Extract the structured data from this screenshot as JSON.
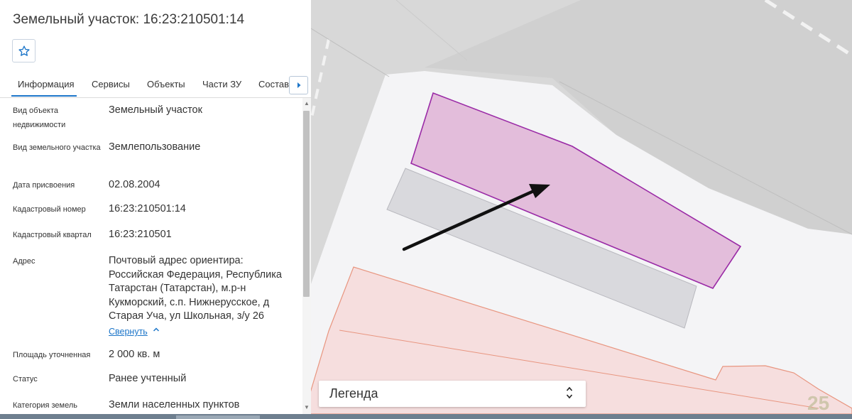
{
  "title": "Земельный участок: 16:23:210501:14",
  "favorite_icon": "star-outline-icon",
  "tabs": [
    {
      "label": "Информация"
    },
    {
      "label": "Сервисы"
    },
    {
      "label": "Объекты"
    },
    {
      "label": "Части ЗУ"
    },
    {
      "label": "Состав"
    }
  ],
  "tabs_scroll_icon": "caret-right-icon",
  "properties": [
    {
      "label": "Вид объекта недвижимости",
      "value": "Земельный участок"
    },
    {
      "label": "Вид земельного участка",
      "value": "Землепользование"
    },
    {
      "label": "Дата присвоения",
      "value": "02.08.2004"
    },
    {
      "label": "Кадастровый номер",
      "value": "16:23:210501:14"
    },
    {
      "label": "Кадастровый квартал",
      "value": "16:23:210501"
    },
    {
      "label": "Адрес",
      "value": "Почтовый адрес ориентира: Российская Федерация, Республика Татарстан (Татарстан), м.р-н Кукморский, с.п. Нижнерусское, д Старая Уча, ул Школьная, з/у 26"
    },
    {
      "label": "Площадь уточненная",
      "value": "2 000 кв. м"
    },
    {
      "label": "Статус",
      "value": "Ранее учтенный"
    },
    {
      "label": "Категория земель",
      "value": "Земли населенных пунктов"
    }
  ],
  "address_collapse_label": "Свернуть",
  "map": {
    "legend_title": "Легенда",
    "zoom_badge": "25",
    "colors": {
      "selected_parcel_fill": "#e3bddb",
      "selected_parcel_stroke": "#9a2aa6",
      "neighbor_parcel_fill": "#f6dede",
      "neighbor_parcel_stroke": "#e8957f",
      "building_fill": "#d9d9dd",
      "road_fill": "#f4f4f6",
      "background": "#d8d8d8"
    }
  },
  "accent_color": "#1d76c9"
}
